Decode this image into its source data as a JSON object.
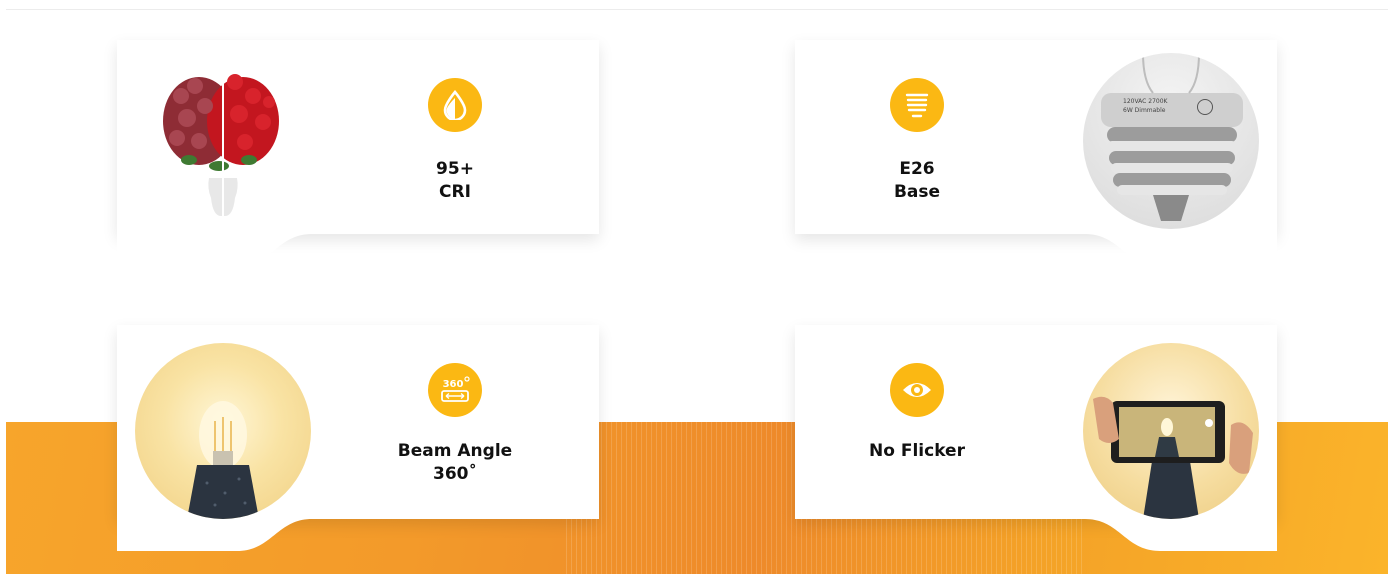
{
  "features": [
    {
      "title": "95+",
      "subtitle": "CRI",
      "icon": "color-drop-icon",
      "image": "roses-vase-image"
    },
    {
      "title": "E26",
      "subtitle": "Base",
      "icon": "screw-base-icon",
      "image": "bulb-base-photo"
    },
    {
      "title": "Beam Angle",
      "subtitle": "360˚",
      "icon": "360-degree-icon",
      "image": "glowing-bulb-photo"
    },
    {
      "title": "No Flicker",
      "subtitle": "",
      "icon": "eye-icon",
      "image": "phone-camera-photo"
    }
  ],
  "icon_text": {
    "angle": "360"
  },
  "base_photo_text": {
    "line1": "120VAC 2700K",
    "line2": "6W Dimmable"
  },
  "colors": {
    "accent": "#fbb813",
    "band_orange": "#f39a2a",
    "text": "#111111"
  }
}
